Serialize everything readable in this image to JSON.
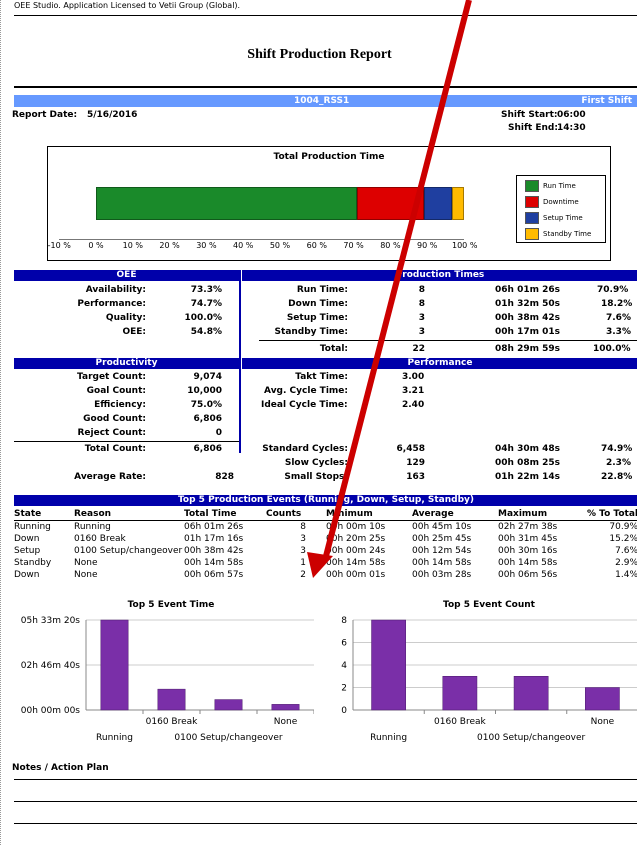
{
  "license": "OEE Studio. Application Licensed to Vetii Group (Global).",
  "report_title": "Shift Production Report",
  "machine": "1004_RSS1",
  "shift": "First Shift",
  "report_date_label": "Report Date:",
  "report_date": "5/16/2016",
  "shift_start_label": "Shift Start:",
  "shift_start": "06:00",
  "shift_end_label": "Shift End:",
  "shift_end": "14:30",
  "production_chart": {
    "title": "Total Production Time",
    "ticks": [
      "-10 %",
      "0 %",
      "10 %",
      "20 %",
      "30 %",
      "40 %",
      "50 %",
      "60 %",
      "70 %",
      "80 %",
      "90 %",
      "100 %"
    ],
    "segments": [
      {
        "name": "Run Time",
        "percent": 70.9,
        "color": "#1a8a2a"
      },
      {
        "name": "Downtime",
        "percent": 18.2,
        "color": "#dd0000"
      },
      {
        "name": "Setup Time",
        "percent": 7.6,
        "color": "#1f3fa0"
      },
      {
        "name": "Standby Time",
        "percent": 3.3,
        "color": "#ffbb00"
      }
    ]
  },
  "oee": {
    "header": "OEE",
    "rows": [
      {
        "label": "Availability:",
        "value": "73.3%"
      },
      {
        "label": "Performance:",
        "value": "74.7%"
      },
      {
        "label": "Quality:",
        "value": "100.0%"
      },
      {
        "label": "OEE:",
        "value": "54.8%"
      }
    ]
  },
  "production_times": {
    "header": "Production Times",
    "rows": [
      {
        "label": "Run Time:",
        "count": "8",
        "time": "06h 01m 26s",
        "pct": "70.9%"
      },
      {
        "label": "Down Time:",
        "count": "8",
        "time": "01h 32m 50s",
        "pct": "18.2%"
      },
      {
        "label": "Setup Time:",
        "count": "3",
        "time": "00h 38m 42s",
        "pct": "7.6%"
      },
      {
        "label": "Standby Time:",
        "count": "3",
        "time": "00h 17m 01s",
        "pct": "3.3%"
      }
    ],
    "total": {
      "label": "Total:",
      "count": "22",
      "time": "08h 29m 59s",
      "pct": "100.0%"
    }
  },
  "productivity": {
    "header": "Productivity",
    "rows": [
      {
        "label": "Target Count:",
        "value": "9,074"
      },
      {
        "label": "Goal Count:",
        "value": "10,000"
      },
      {
        "label": "Efficiency:",
        "value": "75.0%"
      },
      {
        "label": "Good Count:",
        "value": "6,806"
      },
      {
        "label": "Reject Count:",
        "value": "0"
      }
    ],
    "total_label": "Total Count:",
    "total_value": "6,806",
    "avg_label": "Average Rate:",
    "avg_value": "828"
  },
  "performance": {
    "header": "Performance",
    "rows": [
      {
        "label": "Takt Time:",
        "value": "3.00"
      },
      {
        "label": "Avg. Cycle Time:",
        "value": "3.21"
      },
      {
        "label": "Ideal Cycle Time:",
        "value": "2.40"
      }
    ],
    "cycles": [
      {
        "label": "Standard Cycles:",
        "count": "6,458",
        "time": "04h 30m 48s",
        "pct": "74.9%"
      },
      {
        "label": "Slow Cycles:",
        "count": "129",
        "time": "00h 08m 25s",
        "pct": "2.3%"
      },
      {
        "label": "Small Stops:",
        "count": "163",
        "time": "01h 22m 14s",
        "pct": "22.8%"
      }
    ]
  },
  "events": {
    "header": "Top 5 Production Events (Running, Down, Setup, Standby)",
    "columns": [
      "State",
      "Reason",
      "Total Time",
      "Counts",
      "Minimum",
      "Average",
      "Maximum",
      "% To Total"
    ],
    "rows": [
      [
        "Running",
        "Running",
        "06h 01m 26s",
        "8",
        "00h 00m 10s",
        "00h 45m 10s",
        "02h 27m 38s",
        "70.9%"
      ],
      [
        "Down",
        "0160 Break",
        "01h 17m 16s",
        "3",
        "00h 20m 25s",
        "00h 25m 45s",
        "00h 31m 45s",
        "15.2%"
      ],
      [
        "Setup",
        "0100 Setup/changeover",
        "00h 38m 42s",
        "3",
        "00h 00m 24s",
        "00h 12m 54s",
        "00h 30m 16s",
        "7.6%"
      ],
      [
        "Standby",
        "None",
        "00h 14m 58s",
        "1",
        "00h 14m 58s",
        "00h 14m 58s",
        "00h 14m 58s",
        "2.9%"
      ],
      [
        "Down",
        "None",
        "00h 06m 57s",
        "2",
        "00h 00m 01s",
        "00h 03m 28s",
        "00h 06m 56s",
        "1.4%"
      ]
    ]
  },
  "chart_data": [
    {
      "type": "bar",
      "title": "Top 5 Event Time",
      "categories": [
        "Running",
        "0160 Break",
        "0100 Setup/changeover",
        "None"
      ],
      "values_seconds": [
        20000,
        4636,
        2322,
        1255
      ],
      "ytick_labels": [
        "05h 33m 20s",
        "02h 46m 40s",
        "00h 00m 00s"
      ],
      "ylim_seconds": [
        0,
        20000
      ],
      "bar_color": "#7a2fa8"
    },
    {
      "type": "bar",
      "title": "Top 5 Event Count",
      "categories": [
        "Running",
        "0160 Break",
        "0100 Setup/changeover",
        "None"
      ],
      "values": [
        8,
        3,
        3,
        2
      ],
      "ytick_labels": [
        "8",
        "6",
        "4",
        "2",
        "0"
      ],
      "ylim": [
        0,
        8
      ],
      "bar_color": "#7a2fa8"
    }
  ],
  "notes_label": "Notes / Action Plan",
  "annotation_arrow_color": "#cc0000"
}
